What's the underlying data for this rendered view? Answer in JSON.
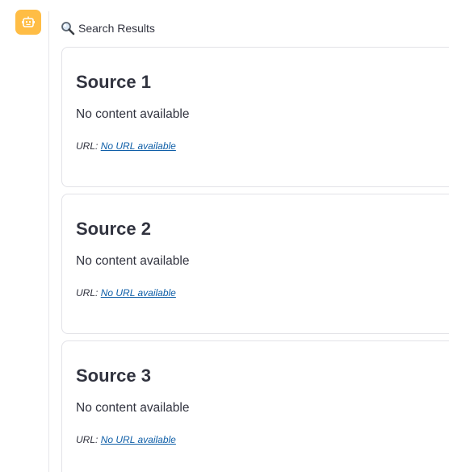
{
  "header": {
    "icon": "magnifying-glass-icon",
    "title": "Search Results"
  },
  "avatar": {
    "icon": "robot-icon",
    "color": "#ffbd45"
  },
  "sources": [
    {
      "title": "Source 1",
      "content": "No content available",
      "url_label": "URL:",
      "url_text": "No URL available"
    },
    {
      "title": "Source 2",
      "content": "No content available",
      "url_label": "URL:",
      "url_text": "No URL available"
    },
    {
      "title": "Source 3",
      "content": "No content available",
      "url_label": "URL:",
      "url_text": "No URL available"
    }
  ]
}
